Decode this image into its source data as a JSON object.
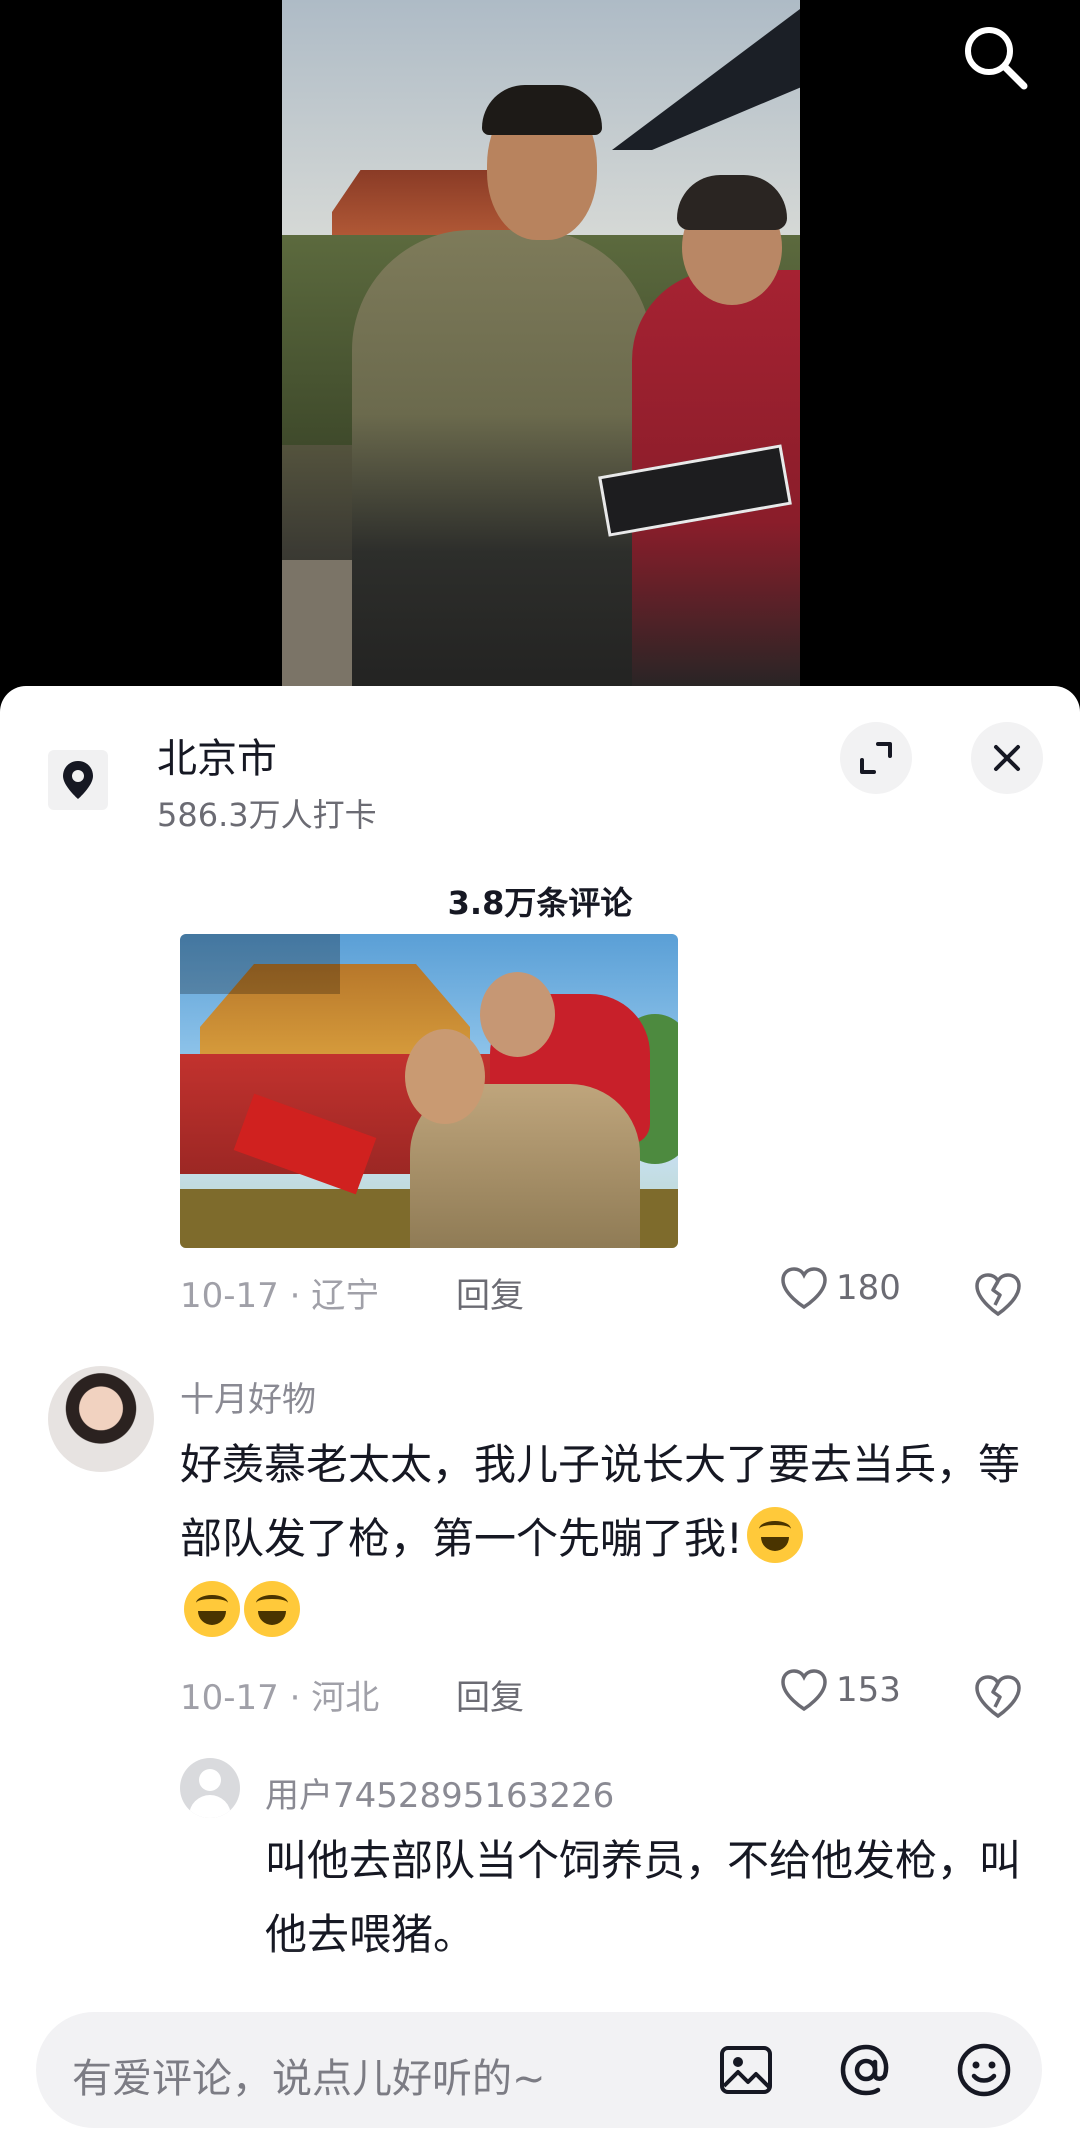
{
  "location": {
    "name": "北京市",
    "checkins": "586.3万人打卡"
  },
  "comments_header": {
    "count_label": "3.8万条评论"
  },
  "comments": [
    {
      "has_image": true,
      "date": "10-17",
      "region": "辽宁",
      "reply_label": "回复",
      "likes": "180"
    },
    {
      "username": "十月好物",
      "text": "好羡慕老太太，我儿子说长大了要去当兵，等部队发了枪，第一个先嘣了我!",
      "emojis": [
        "laughing-tears",
        "laughing-tears",
        "laughing-tears"
      ],
      "date": "10-17",
      "region": "河北",
      "reply_label": "回复",
      "likes": "153",
      "replies": [
        {
          "username": "用户7452895163226",
          "text": "叫他去部队当个饲养员，不给他发枪，叫他去喂猪。"
        }
      ]
    }
  ],
  "input": {
    "placeholder": "有爱评论，说点儿好听的~"
  },
  "icons": {
    "search": "search-icon",
    "location": "location-pin-icon",
    "expand": "expand-icon",
    "close": "close-icon",
    "like": "heart-icon",
    "dislike": "broken-heart-icon",
    "image": "image-icon",
    "mention": "at-icon",
    "emoji": "emoji-icon"
  },
  "colors": {
    "text_primary": "#161823",
    "text_secondary": "#a0a0a8",
    "sheet_bg": "#ffffff",
    "input_bg": "#f2f2f4"
  }
}
